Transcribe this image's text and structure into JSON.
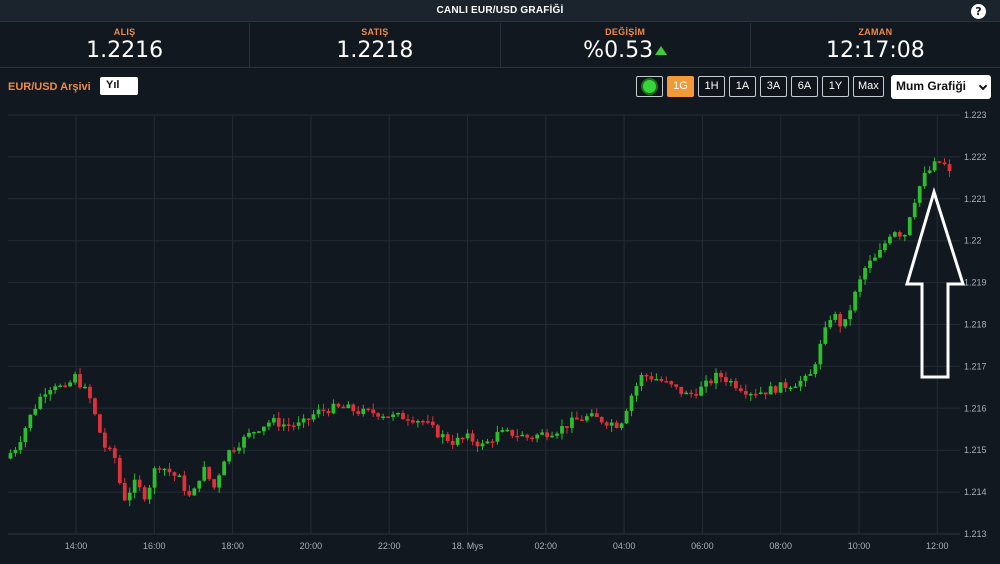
{
  "header": {
    "title": "CANLI EUR/USD GRAFİĞİ",
    "help_label": "?"
  },
  "quotes": [
    {
      "label": "ALIŞ",
      "value": "1.2216"
    },
    {
      "label": "SATIŞ",
      "value": "1.2218"
    },
    {
      "label": "DEĞİŞİM",
      "value": "%0.53",
      "direction": "up"
    },
    {
      "label": "ZAMAN",
      "value": "12:17:08"
    }
  ],
  "toolbar": {
    "archive_label": "EUR/USD Arşivi",
    "archive_value": "Yıl",
    "ranges": [
      "1G",
      "1H",
      "1A",
      "3A",
      "6A",
      "1Y",
      "Max"
    ],
    "active_range": "1G",
    "chart_type": "Mum Grafiği"
  },
  "colors": {
    "up": "#2ebd2e",
    "down": "#e0313a",
    "accent": "#f39a38",
    "label": "#f08a4a"
  },
  "chart_data": {
    "type": "candlestick",
    "x_ticks": [
      "14:00",
      "16:00",
      "18:00",
      "20:00",
      "22:00",
      "18. Mys",
      "02:00",
      "04:00",
      "06:00",
      "08:00",
      "10:00",
      "12:00"
    ],
    "y_ticks": [
      "1.213",
      "1.214",
      "1.215",
      "1.216",
      "1.217",
      "1.218",
      "1.219",
      "1.22",
      "1.221",
      "1.222",
      "1.223"
    ],
    "ylim": [
      1.213,
      1.223
    ],
    "x_range": [
      "12:15",
      "12:40"
    ],
    "grid": true,
    "close_path": [
      [
        0,
        1.2148
      ],
      [
        1.5,
        1.2151
      ],
      [
        3.5,
        1.2159
      ],
      [
        5,
        1.2164
      ],
      [
        6.5,
        1.2166
      ],
      [
        8,
        1.2164
      ],
      [
        9,
        1.2168
      ],
      [
        11,
        1.2163
      ],
      [
        13,
        1.2151
      ],
      [
        14.5,
        1.2148
      ],
      [
        15.5,
        1.2138
      ],
      [
        17,
        1.2142
      ],
      [
        18.5,
        1.2139
      ],
      [
        20,
        1.2147
      ],
      [
        21.5,
        1.2145
      ],
      [
        23,
        1.2143
      ],
      [
        24.5,
        1.2138
      ],
      [
        26,
        1.2146
      ],
      [
        27.5,
        1.2141
      ],
      [
        29,
        1.2149
      ],
      [
        31,
        1.2152
      ],
      [
        33,
        1.2155
      ],
      [
        35,
        1.2157
      ],
      [
        37,
        1.2156
      ],
      [
        39,
        1.2156
      ],
      [
        41,
        1.2159
      ],
      [
        43,
        1.216
      ],
      [
        45,
        1.216
      ],
      [
        47,
        1.2159
      ],
      [
        49,
        1.2159
      ],
      [
        51,
        1.2158
      ],
      [
        53,
        1.2158
      ],
      [
        55,
        1.2157
      ],
      [
        57,
        1.2154
      ],
      [
        59,
        1.2152
      ],
      [
        61,
        1.2153
      ],
      [
        63,
        1.2151
      ],
      [
        65,
        1.2154
      ],
      [
        67,
        1.2154
      ],
      [
        69,
        1.2153
      ],
      [
        71,
        1.2154
      ],
      [
        73,
        1.2155
      ],
      [
        75,
        1.2157
      ],
      [
        77,
        1.2158
      ],
      [
        79,
        1.2157
      ],
      [
        81,
        1.2156
      ],
      [
        82.5,
        1.2163
      ],
      [
        84,
        1.2168
      ],
      [
        86,
        1.2167
      ],
      [
        88,
        1.2165
      ],
      [
        90,
        1.2163
      ],
      [
        92,
        1.2165
      ],
      [
        94,
        1.2168
      ],
      [
        96,
        1.2166
      ],
      [
        98,
        1.2164
      ],
      [
        100,
        1.2164
      ],
      [
        102,
        1.2165
      ],
      [
        104,
        1.2166
      ],
      [
        106,
        1.2167
      ],
      [
        107.5,
        1.2175
      ],
      [
        109,
        1.2183
      ],
      [
        110.5,
        1.2179
      ],
      [
        112,
        1.2187
      ],
      [
        113.5,
        1.2194
      ],
      [
        115,
        1.2196
      ],
      [
        117,
        1.2203
      ],
      [
        118.5,
        1.2201
      ],
      [
        119.5,
        1.2208
      ],
      [
        121,
        1.2215
      ],
      [
        122.5,
        1.2218
      ],
      [
        123.5,
        1.2219
      ],
      [
        124.5,
        1.2216
      ]
    ]
  }
}
